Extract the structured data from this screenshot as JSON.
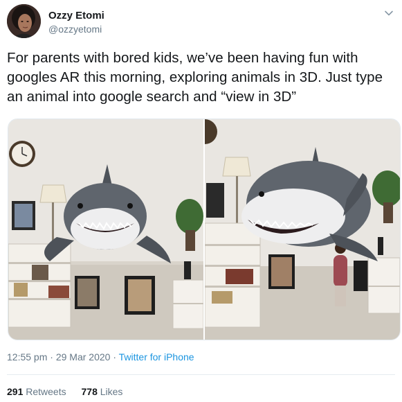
{
  "author": {
    "display_name": "Ozzy Etomi",
    "handle": "@ozzyetomi",
    "avatar_icon": "profile-photo"
  },
  "tweet": {
    "text": "For parents with bored kids, we’ve been having fun with googles AR this morning, exploring animals in 3D. Just type an animal into google search and “view in 3D”"
  },
  "media": {
    "photo_count": 2,
    "photos": [
      "shark-ar-photo-1",
      "shark-ar-photo-2"
    ]
  },
  "meta": {
    "time": "12:55 pm",
    "separator": "·",
    "date": "29 Mar 2020",
    "source": "Twitter for iPhone"
  },
  "stats": {
    "retweets_count": "291",
    "retweets_label": "Retweets",
    "likes_count": "778",
    "likes_label": "Likes"
  },
  "colors": {
    "text": "#14171a",
    "secondary": "#657786",
    "link": "#1b95e0",
    "border": "#e6ecf0"
  }
}
